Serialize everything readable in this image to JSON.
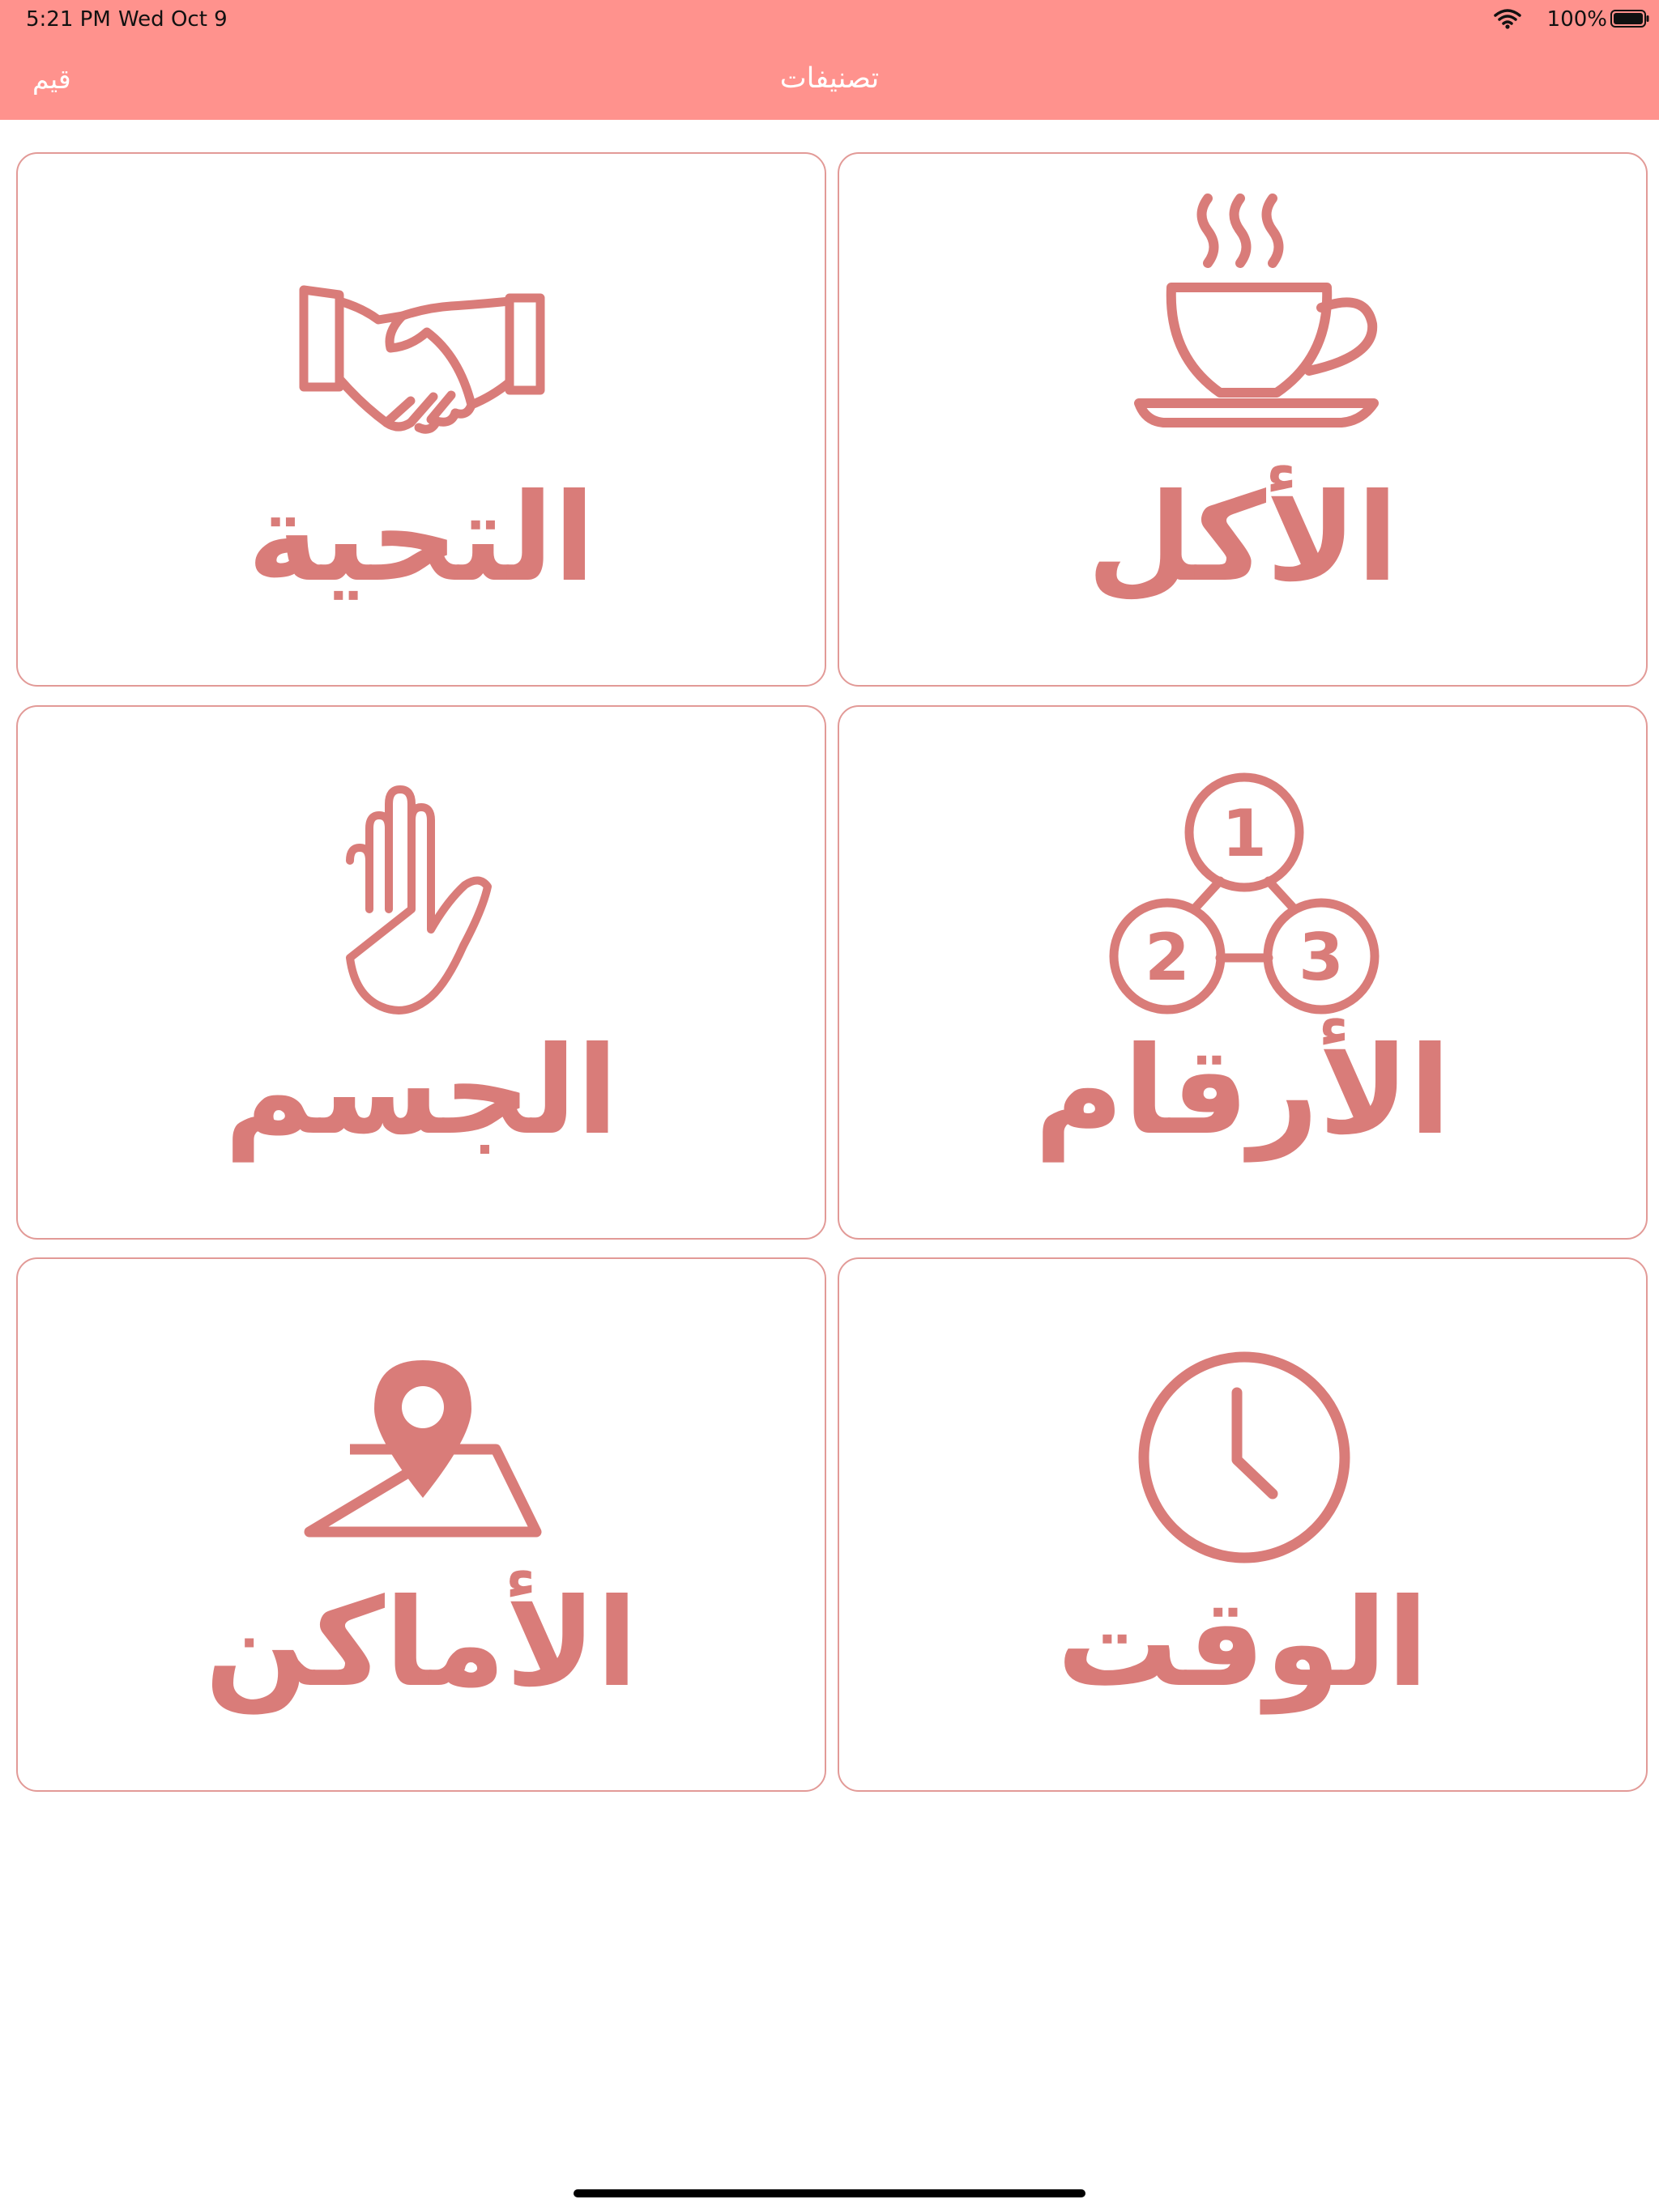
{
  "status_bar": {
    "time": "5:21 PM",
    "date": "Wed Oct 9",
    "battery": "100%"
  },
  "nav": {
    "left_label": "قيم",
    "title": "تصنيفات"
  },
  "categories": [
    {
      "label": "الأكل",
      "icon": "coffee-cup-icon"
    },
    {
      "label": "التحية",
      "icon": "handshake-icon"
    },
    {
      "label": "الأرقام",
      "icon": "numbers-icon"
    },
    {
      "label": "الجسم",
      "icon": "hand-icon"
    },
    {
      "label": "الوقت",
      "icon": "clock-icon"
    },
    {
      "label": "الأماكن",
      "icon": "map-pin-icon"
    }
  ],
  "number_icon_digits": [
    "1",
    "2",
    "3"
  ],
  "colors": {
    "header": "#FF928D",
    "accent": "#D97C79",
    "card_border": "#E29A97"
  }
}
